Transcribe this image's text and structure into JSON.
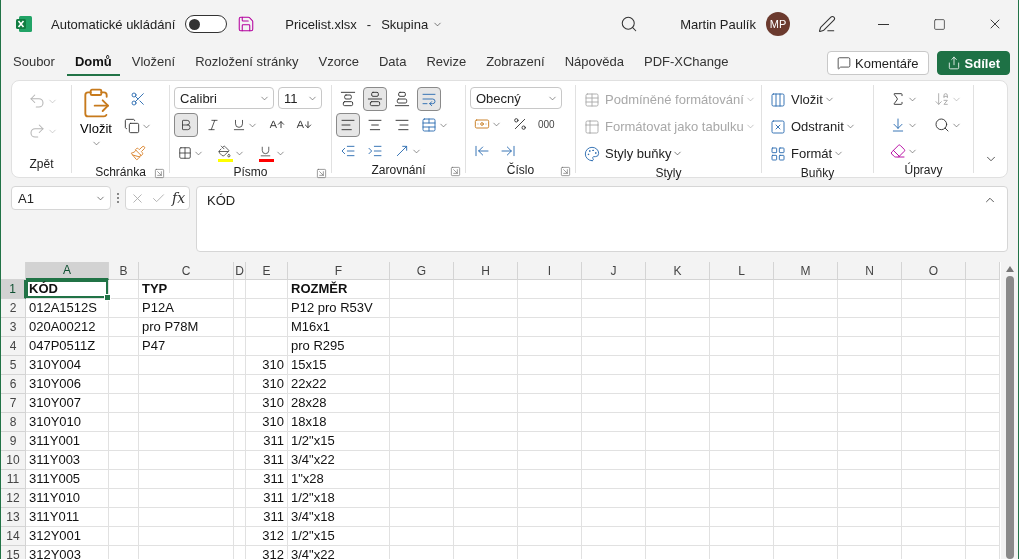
{
  "title_bar": {
    "autosave_label": "Automatické ukládání",
    "autosave_on": false,
    "file_name": "Pricelist.xlsx",
    "separator": "-",
    "location": "Skupina",
    "user_name": "Martin Paulík",
    "user_initials": "MP"
  },
  "menu_tabs": [
    {
      "label": "Soubor",
      "selected": false
    },
    {
      "label": "Domů",
      "selected": true
    },
    {
      "label": "Vložení",
      "selected": false
    },
    {
      "label": "Rozložení stránky",
      "selected": false
    },
    {
      "label": "Vzorce",
      "selected": false
    },
    {
      "label": "Data",
      "selected": false
    },
    {
      "label": "Revize",
      "selected": false
    },
    {
      "label": "Zobrazení",
      "selected": false
    },
    {
      "label": "Nápověda",
      "selected": false
    },
    {
      "label": "PDF-XChange",
      "selected": false
    }
  ],
  "comments_button": "Komentáře",
  "share_button": "Sdílet",
  "ribbon": {
    "undo": {
      "label": "Zpět",
      "disabled": true
    },
    "clipboard": {
      "label": "Schránka",
      "paste": "Vložit"
    },
    "font": {
      "label": "Písmo",
      "font_name": "Calibri",
      "font_size": "11",
      "bold_selected": true
    },
    "alignment": {
      "label": "Zarovnání",
      "middle_selected": true,
      "wrap_selected": true,
      "left_selected": true
    },
    "number": {
      "label": "Číslo",
      "format": "Obecný",
      "thousands": "000"
    },
    "styles": {
      "label": "Styly",
      "items": [
        {
          "label": "Podmíněné formátování",
          "disabled": true
        },
        {
          "label": "Formátovat jako tabulku",
          "disabled": true
        },
        {
          "label": "Styly buňky",
          "disabled": false
        }
      ]
    },
    "cells": {
      "label": "Buňky",
      "items": [
        "Vložit",
        "Odstranit",
        "Formát"
      ]
    },
    "editing": {
      "label": "Úpravy",
      "sort_disabled": true
    }
  },
  "formula_bar": {
    "name_box": "A1",
    "function_label": "fx",
    "content": "KÓD"
  },
  "sheet": {
    "columns": [
      {
        "label": "A",
        "selected": true
      },
      {
        "label": "B",
        "selected": false
      },
      {
        "label": "C",
        "selected": false
      },
      {
        "label": "D",
        "selected": false
      },
      {
        "label": "E",
        "selected": false
      },
      {
        "label": "F",
        "selected": false
      },
      {
        "label": "G",
        "selected": false
      },
      {
        "label": "H",
        "selected": false
      },
      {
        "label": "I",
        "selected": false
      },
      {
        "label": "J",
        "selected": false
      },
      {
        "label": "K",
        "selected": false
      },
      {
        "label": "L",
        "selected": false
      },
      {
        "label": "M",
        "selected": false
      },
      {
        "label": "N",
        "selected": false
      },
      {
        "label": "O",
        "selected": false
      }
    ],
    "rows": [
      {
        "number": "1",
        "selected": true,
        "bold": true,
        "cells": {
          "A": "KÓD",
          "C": "TYP",
          "F": "ROZMĚR"
        }
      },
      {
        "number": "2",
        "selected": false,
        "bold": false,
        "cells": {
          "A": "012A1512S",
          "C": "P12A",
          "F": "P12 pro R53V"
        }
      },
      {
        "number": "3",
        "selected": false,
        "bold": false,
        "cells": {
          "A": "020A00212",
          "C": "pro P78M",
          "F": "M16x1"
        }
      },
      {
        "number": "4",
        "selected": false,
        "bold": false,
        "cells": {
          "A": "047P0511Z",
          "C": "P47",
          "F": "pro R295"
        }
      },
      {
        "number": "5",
        "selected": false,
        "bold": false,
        "cells": {
          "A": "310Y004",
          "E": "310",
          "F": "15x15"
        }
      },
      {
        "number": "6",
        "selected": false,
        "bold": false,
        "cells": {
          "A": "310Y006",
          "E": "310",
          "F": "22x22"
        }
      },
      {
        "number": "7",
        "selected": false,
        "bold": false,
        "cells": {
          "A": "310Y007",
          "E": "310",
          "F": "28x28"
        }
      },
      {
        "number": "8",
        "selected": false,
        "bold": false,
        "cells": {
          "A": "310Y010",
          "E": "310",
          "F": "18x18"
        }
      },
      {
        "number": "9",
        "selected": false,
        "bold": false,
        "cells": {
          "A": "311Y001",
          "E": "311",
          "F": "1/2\"x15"
        }
      },
      {
        "number": "10",
        "selected": false,
        "bold": false,
        "cells": {
          "A": "311Y003",
          "E": "311",
          "F": "3/4\"x22"
        }
      },
      {
        "number": "11",
        "selected": false,
        "bold": false,
        "cells": {
          "A": "311Y005",
          "E": "311",
          "F": "1\"x28"
        }
      },
      {
        "number": "12",
        "selected": false,
        "bold": false,
        "cells": {
          "A": "311Y010",
          "E": "311",
          "F": "1/2\"x18"
        }
      },
      {
        "number": "13",
        "selected": false,
        "bold": false,
        "cells": {
          "A": "311Y011",
          "E": "311",
          "F": "3/4\"x18"
        }
      },
      {
        "number": "14",
        "selected": false,
        "bold": false,
        "cells": {
          "A": "312Y001",
          "E": "312",
          "F": "1/2\"x15"
        }
      },
      {
        "number": "15",
        "selected": false,
        "bold": false,
        "cells": {
          "A": "312Y003",
          "E": "312",
          "F": "3/4\"x22"
        }
      }
    ]
  }
}
